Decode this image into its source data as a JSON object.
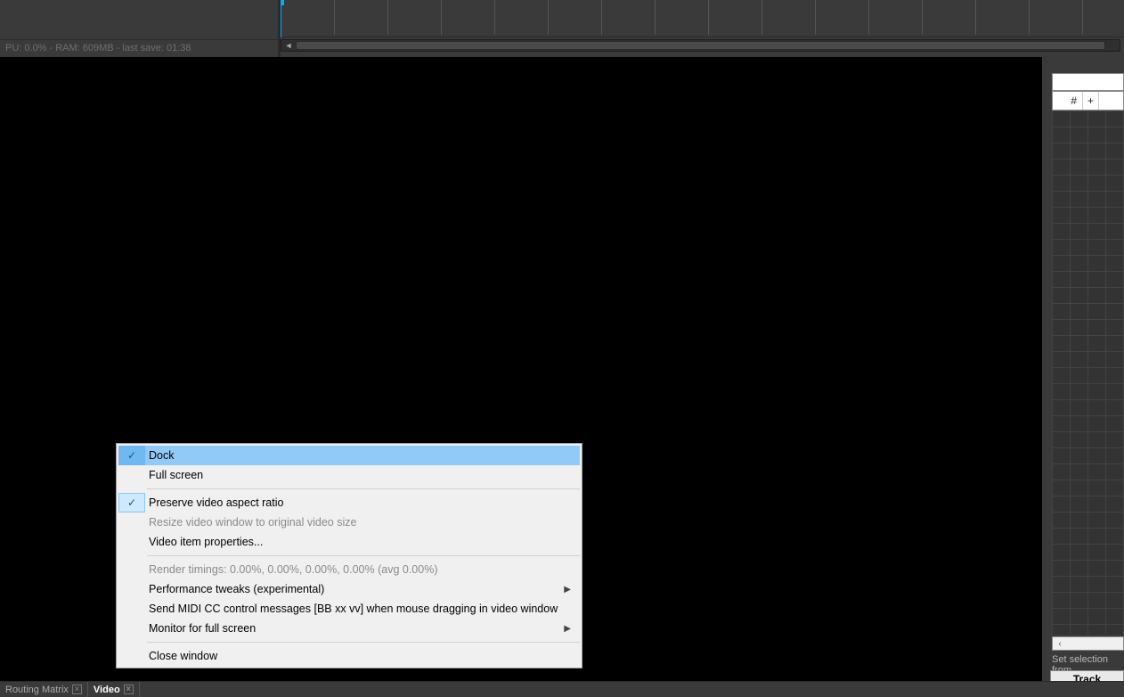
{
  "perf_status": "PU: 0.0% - RAM: 609MB - last save: 01:38",
  "dock_tabs": {
    "routing": "Routing Matrix",
    "video": "Video"
  },
  "side": {
    "hash": "#",
    "plus": "+",
    "hint": "Set selection from",
    "track_manage": "Track Manage"
  },
  "context_menu": {
    "dock": "Dock",
    "full_screen": "Full screen",
    "preserve_aspect": "Preserve video aspect ratio",
    "resize_original": "Resize video window to original video size",
    "video_item_props": "Video item properties...",
    "render_timings": "Render timings: 0.00%, 0.00%, 0.00%, 0.00% (avg 0.00%)",
    "perf_tweaks": "Performance tweaks (experimental)",
    "send_midi_cc": "Send MIDI CC control messages [BB xx vv] when mouse dragging in video window",
    "monitor_fullscreen": "Monitor for full screen",
    "close_window": "Close window"
  }
}
